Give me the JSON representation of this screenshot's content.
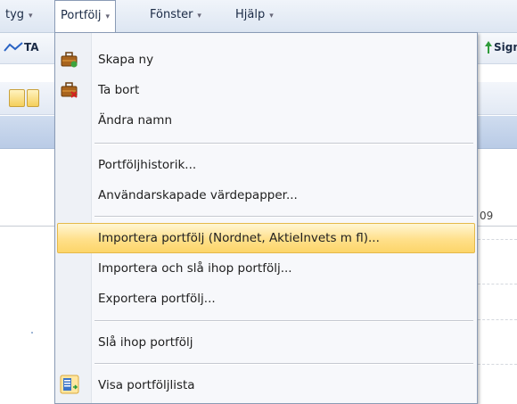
{
  "menubar": {
    "items": [
      {
        "label": "tyg",
        "arrow": "▾"
      },
      {
        "label": "Portfölj",
        "arrow": "▾"
      },
      {
        "label": "Fönster",
        "arrow": "▾"
      },
      {
        "label": "Hjälp",
        "arrow": "▾"
      }
    ]
  },
  "toolbar": {
    "ta_label": "TA",
    "sign_label": "Sign"
  },
  "grid": {
    "header_value": "09"
  },
  "portfolio_menu": {
    "items": [
      {
        "label": "Skapa ny",
        "icon": "briefcase-icon"
      },
      {
        "label": "Ta bort",
        "icon": "briefcase-delete-icon"
      },
      {
        "label": "Ändra namn"
      },
      {
        "label": "Portföljhistorik..."
      },
      {
        "label": "Användarskapade värdepapper..."
      },
      {
        "label": "Importera portfölj (Nordnet, AktieInvets m fl)...",
        "highlighted": true
      },
      {
        "label": "Importera och slå ihop portfölj..."
      },
      {
        "label": "Exportera portfölj..."
      },
      {
        "label": "Slå ihop portfölj"
      },
      {
        "label": "Visa portföljlista",
        "icon": "portfolio-list-icon"
      }
    ]
  },
  "colors": {
    "highlight": "#ffe08a",
    "menubar": "#dde6f2",
    "accent_blue": "#b9cbe6"
  }
}
